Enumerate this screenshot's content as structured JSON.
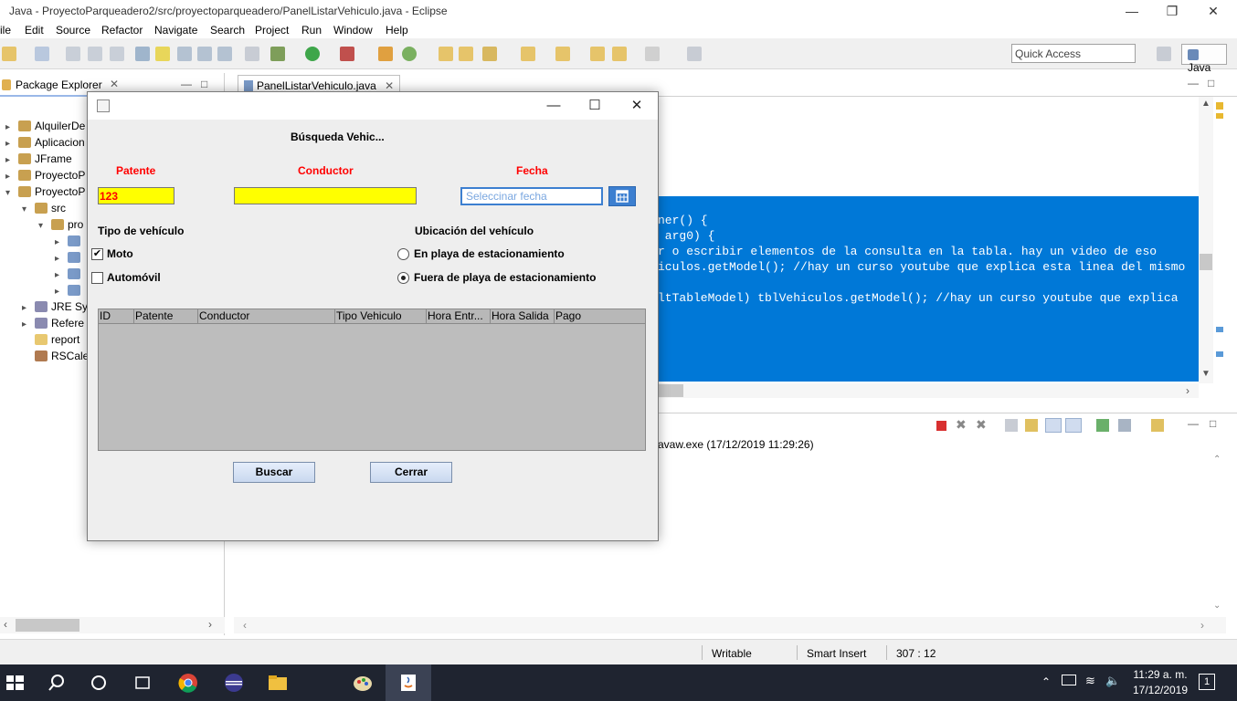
{
  "window": {
    "title": "Java - ProyectoParqueadero2/src/proyectoparqueadero/PanelListarVehiculo.java - Eclipse"
  },
  "menu": [
    "ile",
    "Edit",
    "Source",
    "Refactor",
    "Navigate",
    "Search",
    "Project",
    "Run",
    "Window",
    "Help"
  ],
  "toolbar": {
    "quick_access": "Quick Access",
    "perspective": "Java"
  },
  "package_explorer": {
    "title": "Package Explorer",
    "items": [
      "AlquilerDe",
      "Aplicacion",
      "JFrame",
      "ProyectoP",
      "ProyectoP",
      "src",
      "pro",
      "",
      "",
      "",
      "",
      "JRE Sys",
      "Refere",
      "report",
      "RSCale"
    ]
  },
  "editor": {
    "tab": "PanelListarVehiculo.java",
    "code_lines": [
      "ner() {",
      " arg0) {",
      "r o escribir elementos de la consulta en la tabla. hay un video de eso",
      "iculos.getModel(); //hay un curso youtube que explica esta linea del mismo",
      "",
      "ltTableModel) tblVehiculos.getModel(); //hay un curso youtube que explica"
    ]
  },
  "console": {
    "path": "avaw.exe (17/12/2019 11:29:26)"
  },
  "status": {
    "writable": "Writable",
    "insert_mode": "Smart Insert",
    "position": "307 : 12"
  },
  "taskbar": {
    "time": "11:29 a. m.",
    "date": "17/12/2019",
    "notifications": "1"
  },
  "dialog": {
    "heading": "Búsqueda Vehic...",
    "patente_label": "Patente",
    "conductor_label": "Conductor",
    "fecha_label": "Fecha",
    "patente_value": "123",
    "conductor_value": "",
    "fecha_placeholder": "Seleccinar fecha",
    "tipo_label": "Tipo de vehículo",
    "moto_label": "Moto",
    "moto_checked": true,
    "auto_label": "Automóvil",
    "auto_checked": false,
    "ubicacion_label": "Ubicación del vehículo",
    "radio_en_playa": "En playa de estacionamiento",
    "radio_fuera_playa": "Fuera de playa de estacionamiento",
    "selected_radio": "Fuera de playa de estacionamiento",
    "columns": [
      "ID",
      "Patente",
      "Conductor",
      "Tipo Vehiculo",
      "Hora Entr...",
      "Hora Salida",
      "Pago"
    ],
    "buscar_label": "Buscar",
    "cerrar_label": "Cerrar"
  },
  "colors": {
    "selection": "#0078d7",
    "highlight_field": "#ffff00",
    "label_red": "#ff0000",
    "taskbar": "#1f2430"
  }
}
